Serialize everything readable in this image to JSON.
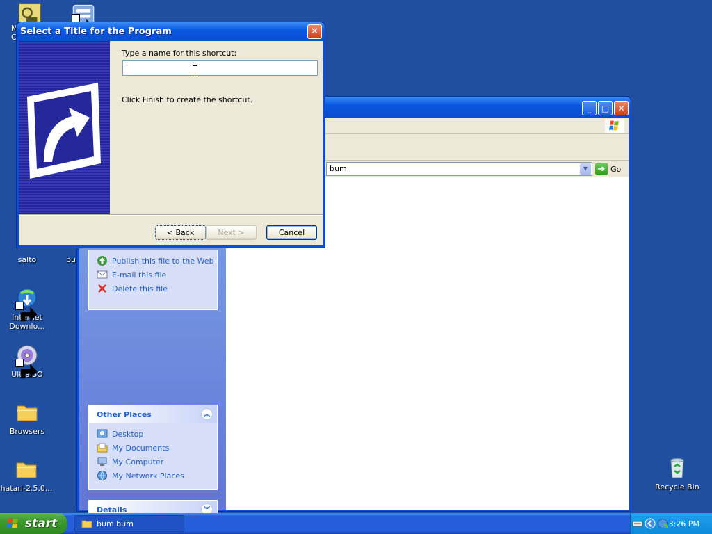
{
  "desktop": {
    "icons": [
      {
        "label": "M\nC",
        "icon": "my-computer-icon"
      },
      {
        "label": "",
        "icon": "program-icon"
      },
      {
        "label": "salto",
        "icon": "shortcut-icon"
      },
      {
        "label": "bur",
        "icon": "shortcut-icon"
      },
      {
        "label": "Internet\nDownlo...",
        "icon": "internet-download-manager-icon"
      },
      {
        "label": "UltraISO",
        "icon": "ultraiso-icon"
      },
      {
        "label": "Browsers",
        "icon": "folder-icon"
      },
      {
        "label": "hatari-2.5.0...",
        "icon": "folder-icon"
      },
      {
        "label": "Recycle Bin",
        "icon": "recycle-bin-icon"
      }
    ]
  },
  "explorer": {
    "address_value": "bum",
    "go_label": "Go",
    "file_tasks": [
      {
        "label": "Publish this file to the Web",
        "icon": "publish-web-icon"
      },
      {
        "label": "E-mail this file",
        "icon": "email-icon"
      },
      {
        "label": "Delete this file",
        "icon": "delete-icon"
      }
    ],
    "other_places": {
      "title": "Other Places",
      "items": [
        {
          "label": "Desktop",
          "icon": "desktop-icon"
        },
        {
          "label": "My Documents",
          "icon": "my-documents-icon"
        },
        {
          "label": "My Computer",
          "icon": "my-computer-icon"
        },
        {
          "label": "My Network Places",
          "icon": "network-places-icon"
        }
      ]
    },
    "details": {
      "title": "Details"
    }
  },
  "dialog": {
    "title": "Select a Title for the Program",
    "name_label": "Type a name for this shortcut:",
    "name_value": "",
    "finish_text": "Click Finish to create the shortcut.",
    "back_label": "< Back",
    "next_label": "Next >",
    "cancel_label": "Cancel"
  },
  "taskbar": {
    "start_label": "start",
    "task_label": "bum bum",
    "clock": "3:26 PM"
  },
  "colors": {
    "desktop": "#1f4f9e",
    "xp_blue": "#0a4fd6",
    "dialog_face": "#ece9d8",
    "link_blue": "#215dc6"
  }
}
